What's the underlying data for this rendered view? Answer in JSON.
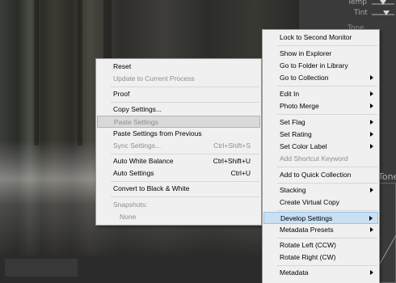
{
  "right_panel": {
    "temp_label": "Temp",
    "tint_label": "Tint",
    "tone_label": "Tone",
    "tone_partial": "Tone"
  },
  "left_menu": {
    "items": [
      {
        "label": "Reset",
        "shortcut": "",
        "state": "normal"
      },
      {
        "label": "Update to Current Process",
        "shortcut": "",
        "state": "disabled"
      },
      {
        "label": "Proof",
        "shortcut": "",
        "state": "normal"
      },
      {
        "label": "Copy Settings...",
        "shortcut": "",
        "state": "normal"
      },
      {
        "label": "Paste Settings",
        "shortcut": "",
        "state": "disabled-pressed"
      },
      {
        "label": "Paste Settings from Previous",
        "shortcut": "",
        "state": "normal"
      },
      {
        "label": "Sync Settings...",
        "shortcut": "Ctrl+Shift+S",
        "state": "disabled"
      },
      {
        "label": "Auto White Balance",
        "shortcut": "Ctrl+Shift+U",
        "state": "normal"
      },
      {
        "label": "Auto Settings",
        "shortcut": "Ctrl+U",
        "state": "normal"
      },
      {
        "label": "Convert to Black & White",
        "shortcut": "",
        "state": "normal"
      },
      {
        "label": "Snapshots:",
        "shortcut": "",
        "state": "disabled"
      },
      {
        "label": "None",
        "shortcut": "",
        "state": "disabled"
      }
    ]
  },
  "right_menu": {
    "items": [
      {
        "label": "Lock to Second Monitor",
        "submenu": false,
        "state": "normal"
      },
      {
        "label": "Show in Explorer",
        "submenu": false,
        "state": "normal"
      },
      {
        "label": "Go to Folder in Library",
        "submenu": false,
        "state": "normal"
      },
      {
        "label": "Go to Collection",
        "submenu": true,
        "state": "normal"
      },
      {
        "label": "Edit In",
        "submenu": true,
        "state": "normal"
      },
      {
        "label": "Photo Merge",
        "submenu": true,
        "state": "normal"
      },
      {
        "label": "Set Flag",
        "submenu": true,
        "state": "normal"
      },
      {
        "label": "Set Rating",
        "submenu": true,
        "state": "normal"
      },
      {
        "label": "Set Color Label",
        "submenu": true,
        "state": "normal"
      },
      {
        "label": "Add Shortcut Keyword",
        "submenu": false,
        "state": "disabled"
      },
      {
        "label": "Add to Quick Collection",
        "submenu": false,
        "state": "normal"
      },
      {
        "label": "Stacking",
        "submenu": true,
        "state": "normal"
      },
      {
        "label": "Create Virtual Copy",
        "submenu": false,
        "state": "normal"
      },
      {
        "label": "Develop Settings",
        "submenu": true,
        "state": "highlighted"
      },
      {
        "label": "Metadata Presets",
        "submenu": true,
        "state": "normal"
      },
      {
        "label": "Rotate Left (CCW)",
        "submenu": false,
        "state": "normal"
      },
      {
        "label": "Rotate Right (CW)",
        "submenu": false,
        "state": "normal"
      },
      {
        "label": "Metadata",
        "submenu": true,
        "state": "normal"
      }
    ]
  },
  "colors": {
    "menu_bg": "#f0f0f0",
    "highlight": "#c9dff3",
    "disabled_text": "#8d8d8d"
  }
}
